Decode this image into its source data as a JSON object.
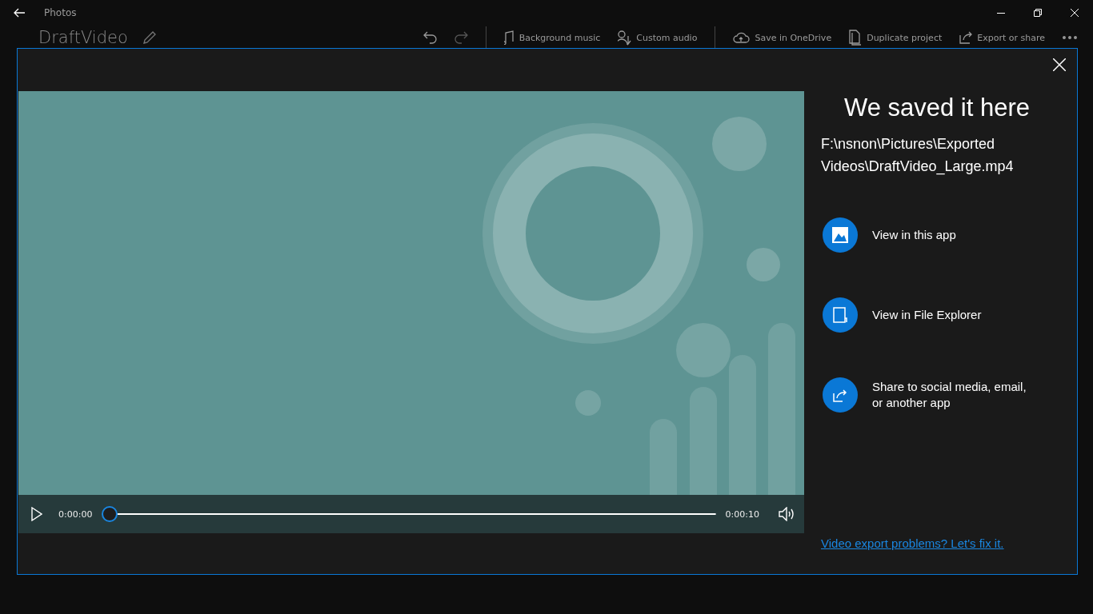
{
  "window": {
    "title": "Photos"
  },
  "project": {
    "title": "DraftVideo"
  },
  "toolbar": [
    {
      "kind": "undo"
    },
    {
      "kind": "redo",
      "disabled": true
    },
    {
      "kind": "separator"
    },
    {
      "kind": "music",
      "label": "Background music"
    },
    {
      "kind": "audio",
      "label": "Custom audio"
    },
    {
      "kind": "separator"
    },
    {
      "kind": "cloud",
      "label": "Save in OneDrive"
    },
    {
      "kind": "duplicate",
      "label": "Duplicate project"
    },
    {
      "kind": "export",
      "label": "Export or share"
    },
    {
      "kind": "more"
    }
  ],
  "dialog": {
    "title": "We saved it here",
    "path": "F:\\nsnon\\Pictures\\Exported Videos\\DraftVideo_Large.mp4",
    "player": {
      "kind": "picture",
      "current_time": "0:00:00",
      "duration": "0:00:10",
      "level": 0
    },
    "actions": [
      {
        "label": "View in this app"
      },
      {
        "kind": "folder",
        "label": "View in File Explorer"
      },
      {
        "kind": "share",
        "label": "Share to social media, email, or another app"
      }
    ],
    "help_link": "Video export problems? Let's fix it."
  }
}
